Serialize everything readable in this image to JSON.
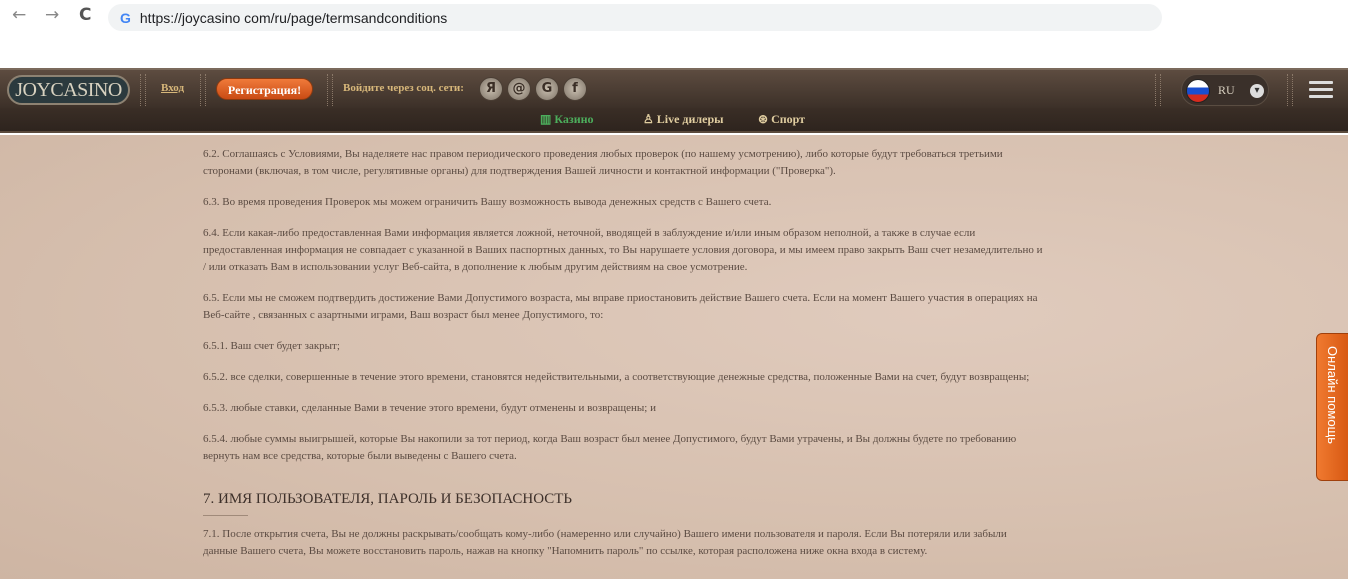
{
  "browser": {
    "url": "https://joycasino com/ru/page/termsandconditions",
    "back": "←",
    "forward": "→",
    "reload": "C",
    "google": "G"
  },
  "header": {
    "logo": "JOYCASINO",
    "login": "Вход",
    "register": "Регистрация!",
    "social_label": "Войдите через соц. сети:",
    "social": [
      "Я",
      "@",
      "G",
      "f"
    ],
    "lang": "RU"
  },
  "nav": {
    "items": [
      {
        "label": "Казино",
        "icon": "slot-icon"
      },
      {
        "label": "Live дилеры",
        "icon": "dealer-icon"
      },
      {
        "label": "Спорт",
        "icon": "ball-icon"
      }
    ]
  },
  "content": {
    "p62": [
      "6.2. Соглашаясь с Условиями, Вы наделяете нас правом периодического проведения любых проверок (по нашему усмотрению), либо которые будут требоваться третьими",
      "сторонами (включая, в том числе, регулятивные органы) для подтверждения Вашей личности и контактной информации (\"Проверка\")."
    ],
    "p63": "6.3. Во время проведения Проверок мы можем ограничить Вашу возможность вывода денежных средств с Вашего счета.",
    "p64": [
      "6.4. Если какая-либо предоставленная Вами информация является ложной, неточной, вводящей в заблуждение и/или иным образом неполной, а также в случае если",
      "предоставленная информация не совпадает с указанной в Ваших паспортных данных, то Вы нарушаете условия договора, и мы имеем право закрыть Ваш счет незамедлительно и",
      "/ или отказать Вам в использовании услуг Веб-сайта, в дополнение к любым другим действиям на свое усмотрение."
    ],
    "p65": [
      "6.5. Если мы не сможем подтвердить достижение Вами Допустимого возраста, мы вправе приостановить действие Вашего счета. Если на момент Вашего участия в операциях на",
      "Веб-сайте , связанных с азартными играми, Ваш возраст был менее Допустимого, то:"
    ],
    "p651": "6.5.1. Ваш счет будет закрыт;",
    "p652": "6.5.2. все сделки, совершенные в течение этого времени, становятся недействительными, а соответствующие денежные средства, положенные Вами на счет, будут возвращены;",
    "p653": "6.5.3. любые ставки, сделанные Вами в течение этого времени, будут отменены и возвращены; и",
    "p654": [
      "6.5.4. любые суммы выигрышей, которые Вы накопили за тот период, когда Ваш возраст был менее Допустимого, будут Вами утрачены, и Вы должны будете по требованию",
      "вернуть нам все средства, которые были выведены с Вашего счета."
    ],
    "h7": "7. ИМЯ ПОЛЬЗОВАТЕЛЯ, ПАРОЛЬ И БЕЗОПАСНОСТЬ",
    "p71": [
      "7.1. После открытия счета, Вы не должны раскрывать/сообщать кому-либо (намеренно или случайно) Вашего имени пользователя и пароля. Если Вы потеряли или забыли",
      "данные Вашего счета, Вы можете восстановить пароль, нажав на кнопку \"Напомнить пароль\" по ссылке, которая расположена ниже окна входа в систему."
    ]
  },
  "help": "Онлайн помощь"
}
